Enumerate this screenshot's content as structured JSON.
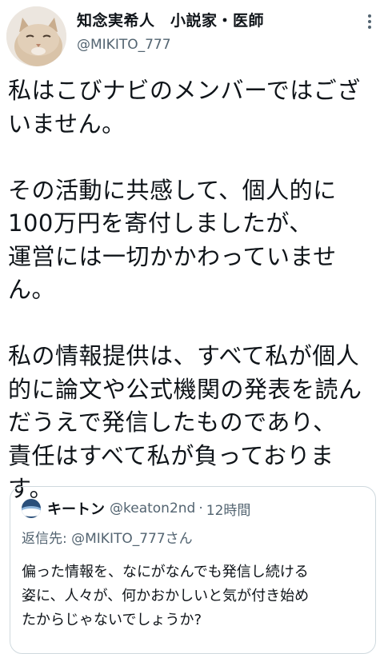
{
  "author": {
    "display_name": "知念実希人　小説家・医師",
    "handle": "@MIKITO_777",
    "avatar_icon": "cat-avatar-icon"
  },
  "more_icon": "more-options-icon",
  "tweet": {
    "lines": [
      "私はこびナビのメンバーではござ",
      "いません。",
      "",
      "その活動に共感して、個人的に",
      "100万円を寄付しましたが、",
      "運営には一切かかわっていませ",
      "ん。",
      "",
      "私の情報提供は、すべて私が個人",
      "的に論文や公式機関の発表を読ん",
      "だうえで発信したものであり、",
      "責任はすべて私が負っておりま",
      "す。"
    ]
  },
  "quote": {
    "name": "キートン",
    "handle": "@keaton2nd",
    "separator": "·",
    "time": "12時間",
    "reply_to": "返信先: @MIKITO_777さん",
    "lines": [
      "偏った情報を、なにがなんでも発信し続ける",
      "姿に、人々が、何かおかしいと気が付き始め",
      "たからじゃないでしょうか?"
    ]
  },
  "colors": {
    "text": "#0f1419",
    "secondary": "#536471",
    "border": "#cfd9de"
  }
}
